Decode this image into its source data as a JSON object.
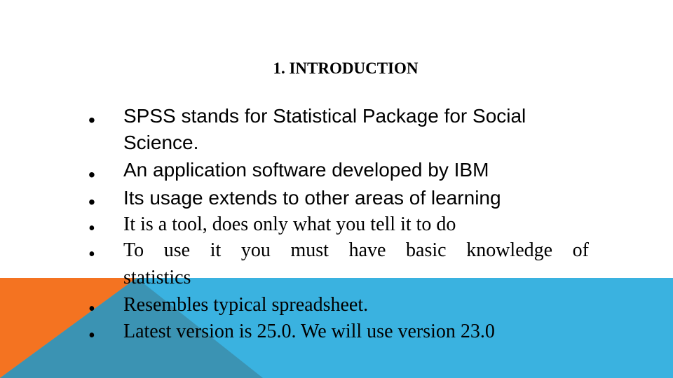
{
  "slide": {
    "title": "1. INTRODUCTION",
    "bullets": [
      {
        "line1": "SPSS stands for Statistical Package for Social",
        "line2": "Science."
      },
      {
        "line1": "An application software developed by IBM"
      },
      {
        "line1": "Its usage extends to other areas of learning"
      },
      {
        "line1": "It is a tool, does only what you tell it to do"
      },
      {
        "line1": "To use it you must have basic knowledge of",
        "line2": "statistics"
      },
      {
        "line1": "Resembles typical spreadsheet."
      },
      {
        "line1": "Latest version is 25.0. We will use version 23.0"
      }
    ],
    "bullet_glyph": "•"
  },
  "theme": {
    "band_blue": "#3AB2E0",
    "band_orange": "#F47321",
    "band_teal": "#3B93B3"
  }
}
